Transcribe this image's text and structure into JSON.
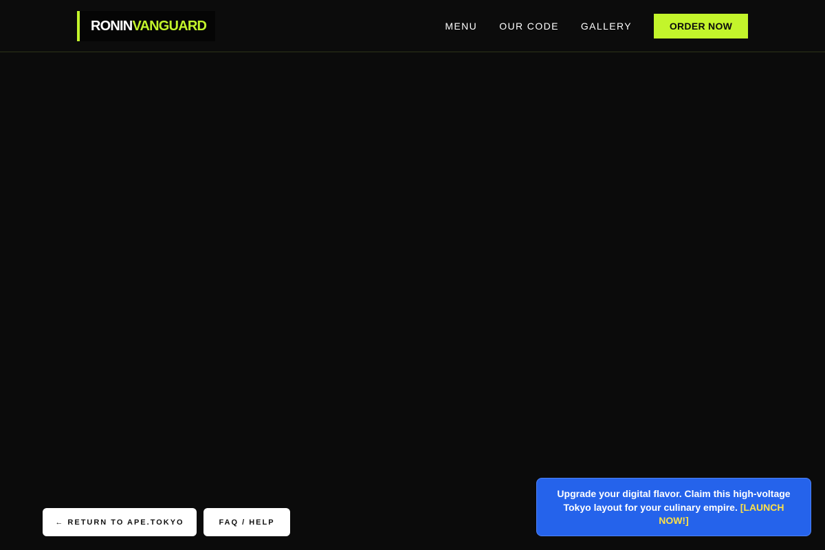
{
  "header": {
    "logo": {
      "part1": "RONIN",
      "part2": "VANGUARD"
    },
    "nav": [
      {
        "label": "MENU"
      },
      {
        "label": "OUR CODE"
      },
      {
        "label": "GALLERY"
      }
    ],
    "cta_label": "ORDER NOW"
  },
  "footer_buttons": {
    "return_label": "← RETURN TO APE.TOKYO",
    "faq_label": "FAQ / HELP"
  },
  "promo": {
    "text": "Upgrade your digital flavor. Claim this high-voltage Tokyo layout for your culinary empire.",
    "link_label": "[LAUNCH NOW!]"
  },
  "colors": {
    "accent": "#c3f52b",
    "background": "#0b0b0b",
    "promo_bg": "#2563eb",
    "promo_link": "#fde047"
  }
}
